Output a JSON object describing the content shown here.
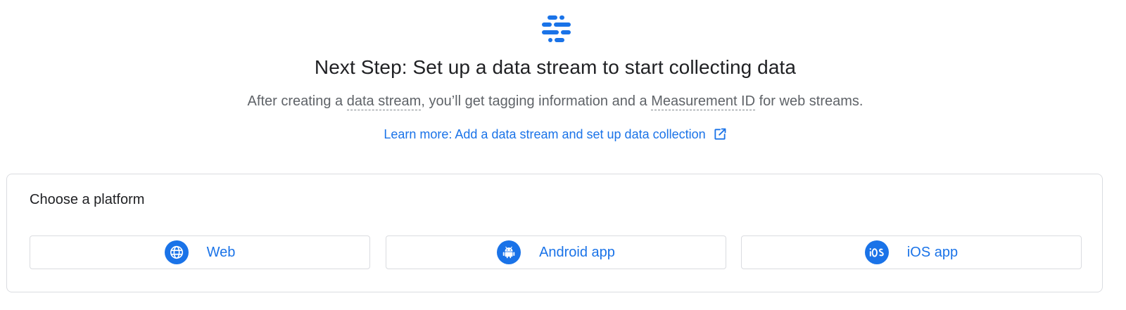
{
  "header": {
    "icon": "data-stream-icon",
    "title": "Next Step: Set up a data stream to start collecting data",
    "subtitle_before": "After creating a ",
    "subtitle_term1": "data stream",
    "subtitle_middle": ", you’ll get tagging information and a ",
    "subtitle_term2": "Measurement ID",
    "subtitle_after": " for web streams.",
    "learn_more": "Learn more: Add a data stream and set up data collection",
    "learn_more_icon": "open-in-new-icon"
  },
  "platform": {
    "title": "Choose a platform",
    "buttons": [
      {
        "label": "Web",
        "icon": "globe-icon"
      },
      {
        "label": "Android app",
        "icon": "android-icon"
      },
      {
        "label": "iOS app",
        "icon": "ios-icon"
      }
    ]
  },
  "colors": {
    "accent": "#1a73e8",
    "text_primary": "#202124",
    "text_secondary": "#5f6368",
    "border": "#dadce0"
  }
}
